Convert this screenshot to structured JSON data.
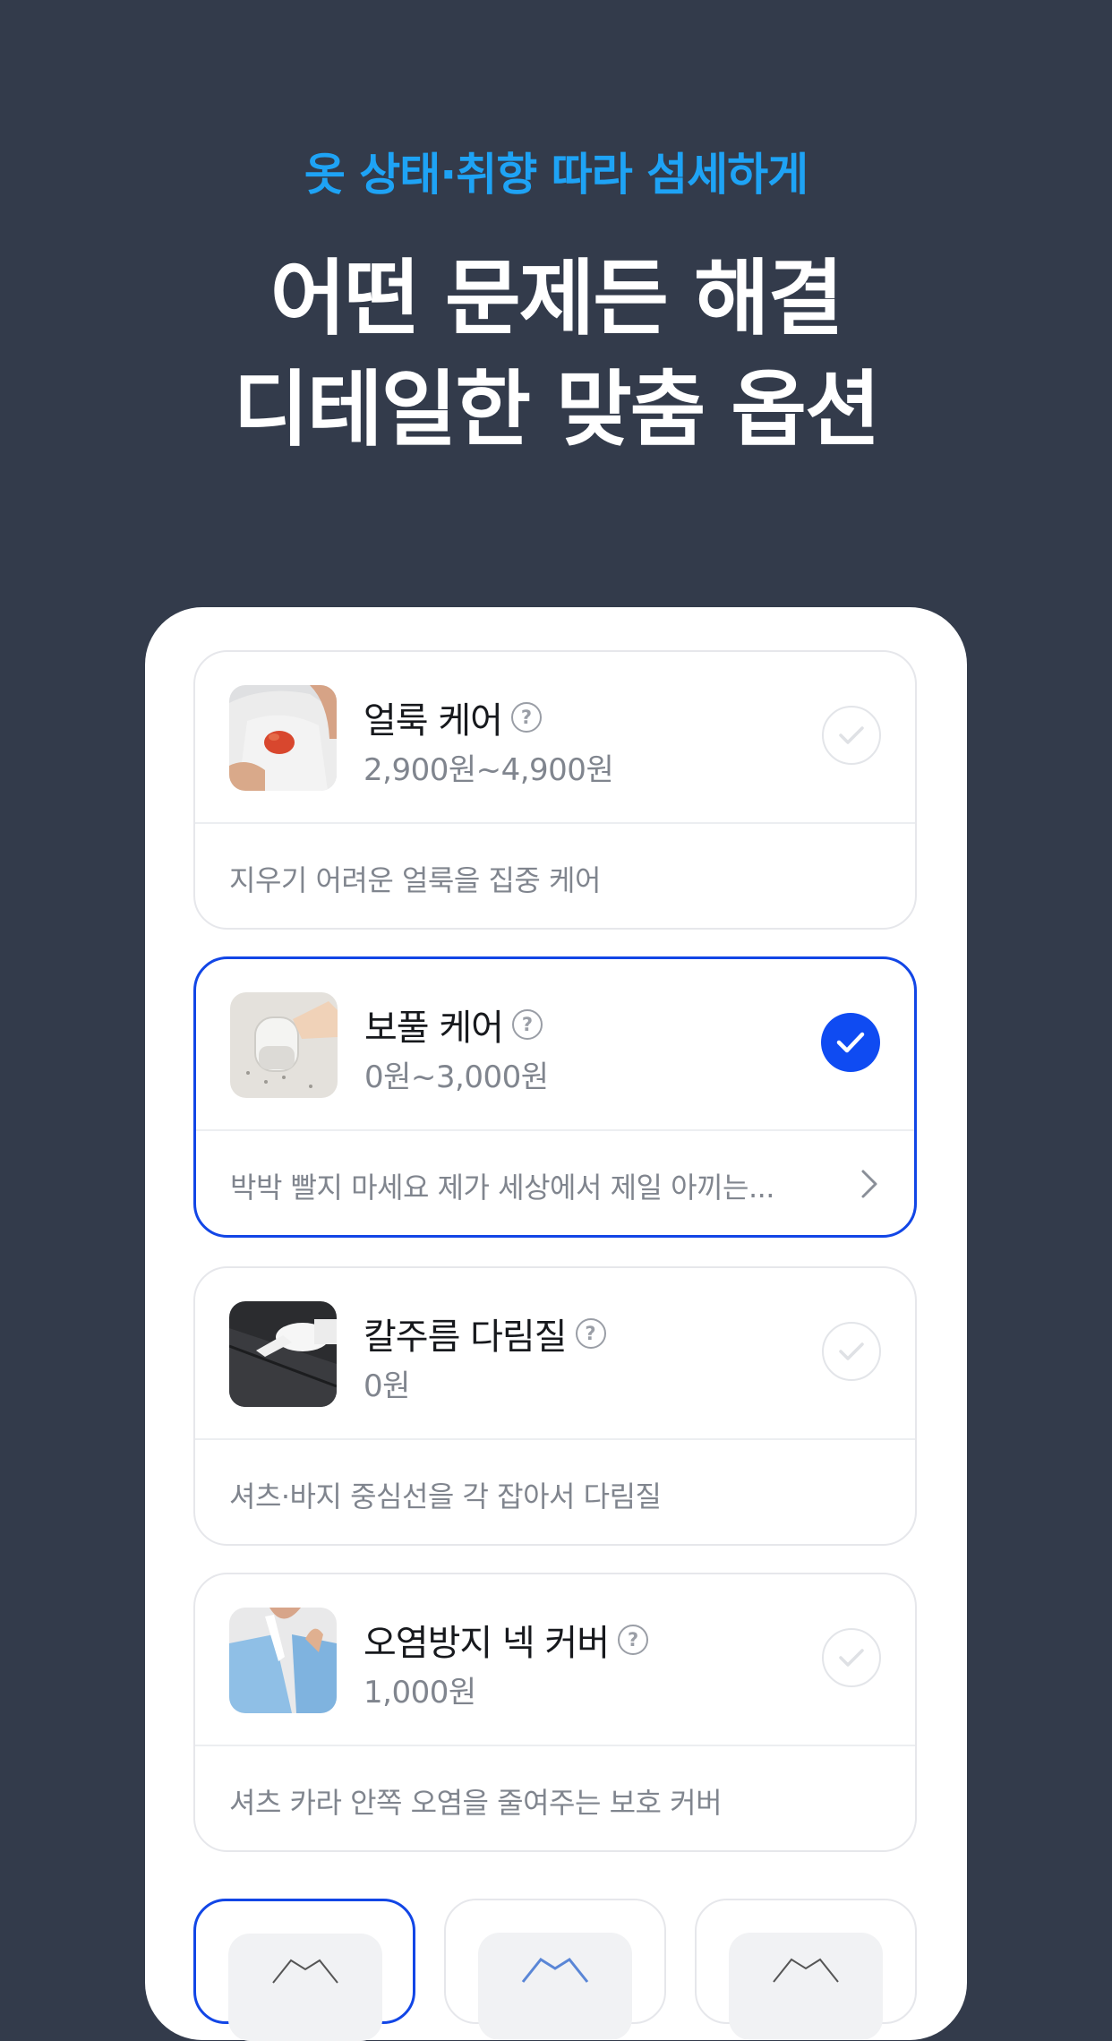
{
  "header": {
    "eyebrow": "옷 상태·취향 따라 섬세하게",
    "headline_line1": "어떤 문제든 해결",
    "headline_line2": "디테일한 맞춤 옵션"
  },
  "help_glyph": "?",
  "options": [
    {
      "title": "얼룩 케어",
      "price": "2,900원~4,900원",
      "desc": "지우기 어려운 얼룩을 집중 케어",
      "selected": false,
      "thumb_icon": "stain-shirt-photo"
    },
    {
      "title": "보풀 케어",
      "price": "0원~3,000원",
      "desc": "박박 빨지 마세요 제가 세상에서 제일 아끼는...",
      "selected": true,
      "thumb_icon": "lint-remover-photo"
    },
    {
      "title": "칼주름 다림질",
      "price": "0원",
      "desc": "셔츠·바지 중심선을 각 잡아서 다림질",
      "selected": false,
      "thumb_icon": "pressing-trousers-photo"
    },
    {
      "title": "오염방지 넥 커버",
      "price": "1,000원",
      "desc": "셔츠 카라 안쪽 오염을 줄여주는 보호 커버",
      "selected": false,
      "thumb_icon": "shirt-collar-photo"
    }
  ],
  "colors": {
    "background": "#333b4b",
    "accent_blue": "#1ea3f5",
    "selected_blue": "#0f4bf2"
  }
}
